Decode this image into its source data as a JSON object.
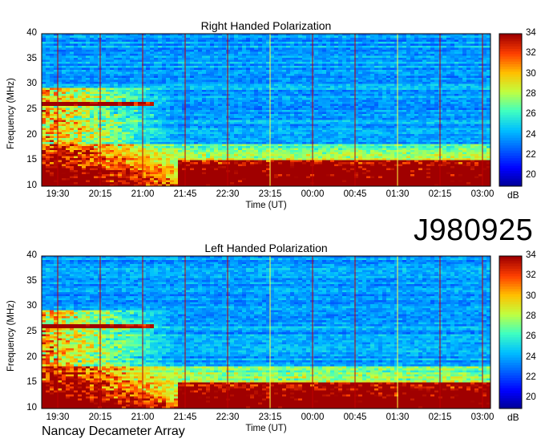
{
  "figure_id": "J980925",
  "footer": "Nancay Decameter Array",
  "colors": {
    "colormap": [
      "#00008f",
      "#0000ff",
      "#0060ff",
      "#00c0ff",
      "#40ffc0",
      "#c0ff40",
      "#ffc000",
      "#ff4000",
      "#a00000"
    ],
    "red_marker": "#c00000",
    "yellow_marker": "#ffff40"
  },
  "chart_data": [
    {
      "type": "heatmap",
      "title": "Right Handed Polarization",
      "xlabel": "Time (UT)",
      "ylabel": "Frequency (MHz)",
      "x_ticks": [
        "19:30",
        "20:15",
        "21:00",
        "21:45",
        "22:30",
        "23:15",
        "00:00",
        "00:45",
        "01:30",
        "02:15",
        "03:00"
      ],
      "y_ticks": [
        10,
        15,
        20,
        25,
        30,
        35,
        40
      ],
      "ylim": [
        10,
        40
      ],
      "colorbar": {
        "label": "dB",
        "ticks": [
          20,
          22,
          24,
          26,
          28,
          30,
          32,
          34
        ],
        "range": [
          19,
          34
        ]
      }
    },
    {
      "type": "heatmap",
      "title": "Left Handed Polarization",
      "xlabel": "Time (UT)",
      "ylabel": "Frequency (MHz)",
      "x_ticks": [
        "19:30",
        "20:15",
        "21:00",
        "21:45",
        "22:30",
        "23:15",
        "00:00",
        "00:45",
        "01:30",
        "02:15",
        "03:00"
      ],
      "y_ticks": [
        10,
        15,
        20,
        25,
        30,
        35,
        40
      ],
      "ylim": [
        10,
        40
      ],
      "colorbar": {
        "label": "dB",
        "ticks": [
          20,
          22,
          24,
          26,
          28,
          30,
          32,
          34
        ],
        "range": [
          19,
          34
        ]
      }
    }
  ]
}
